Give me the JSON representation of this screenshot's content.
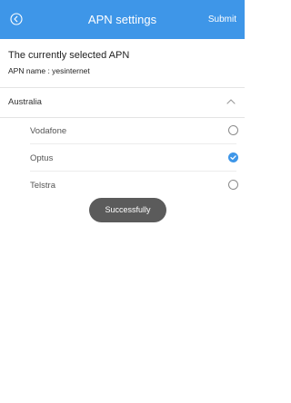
{
  "header": {
    "title": "APN settings",
    "submit_label": "Submit",
    "back_icon": "circle-arrow-left-icon",
    "bg_color": "#3e96e8"
  },
  "current": {
    "heading": "The currently selected APN",
    "apn_name": "APN name : yesinternet"
  },
  "group": {
    "label": "Australia",
    "expanded": true,
    "toggle_icon": "chevron-up-icon"
  },
  "options": [
    {
      "label": "Vodafone",
      "selected": false
    },
    {
      "label": "Optus",
      "selected": true
    },
    {
      "label": "Telstra",
      "selected": false
    }
  ],
  "toast": {
    "text": "Successfully"
  }
}
